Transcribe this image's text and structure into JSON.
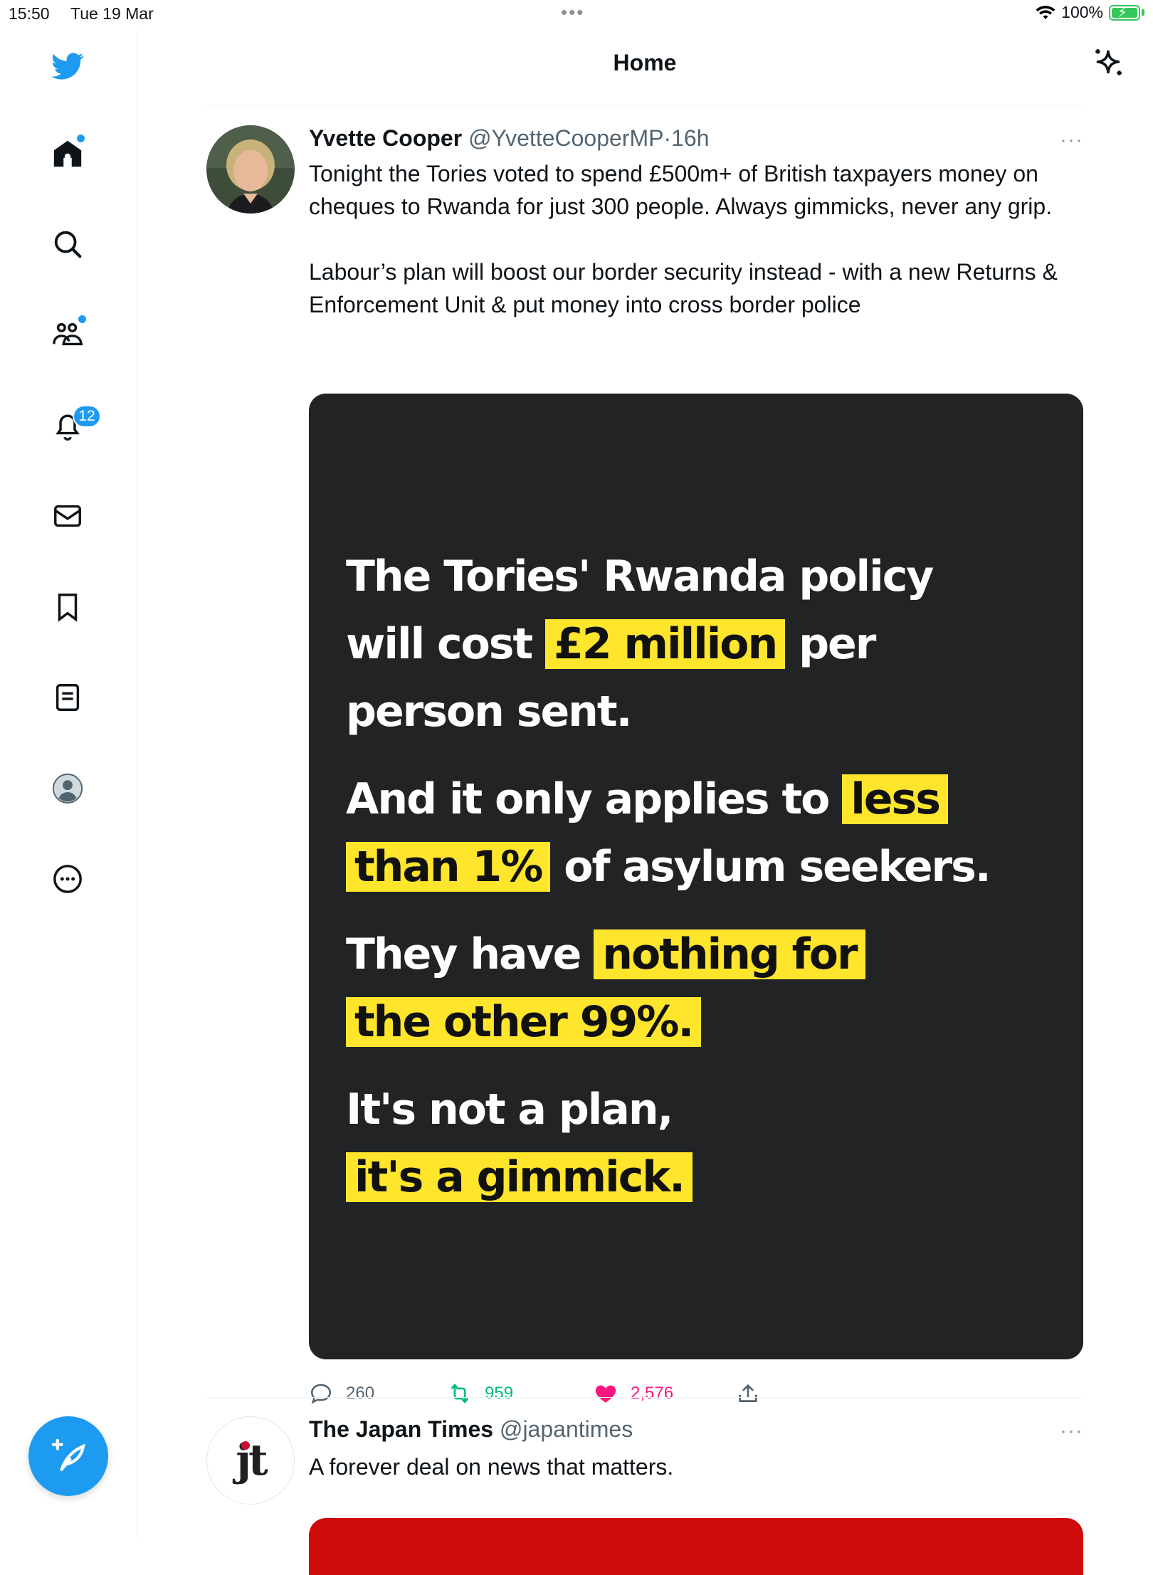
{
  "status_bar": {
    "time": "15:50",
    "date": "Tue 19 Mar",
    "battery": "100%"
  },
  "header": {
    "title": "Home"
  },
  "sidebar": {
    "items": [
      {
        "name": "logo",
        "icon": "twitter-bird-icon"
      },
      {
        "name": "home",
        "icon": "home-icon"
      },
      {
        "name": "explore",
        "icon": "search-icon"
      },
      {
        "name": "communities",
        "icon": "communities-icon"
      },
      {
        "name": "notifications",
        "icon": "bell-icon",
        "badge": "12"
      },
      {
        "name": "messages",
        "icon": "mail-icon"
      },
      {
        "name": "bookmarks",
        "icon": "bookmark-icon"
      },
      {
        "name": "lists",
        "icon": "list-icon"
      },
      {
        "name": "profile",
        "icon": "profile-avatar-icon"
      },
      {
        "name": "more",
        "icon": "more-circle-icon"
      }
    ],
    "compose_icon": "compose-feather-icon"
  },
  "tweets": [
    {
      "name": "Yvette Cooper",
      "handle": "@YvetteCooperMP",
      "sep": "·",
      "time": "16h",
      "more": "···",
      "text": "Tonight the Tories voted to spend £500m+ of British taxpayers money on cheques to Rwanda for just 300 people. Always gimmicks, never any grip.\n\nLabour’s plan will boost our border security instead - with a new Returns & Enforcement Unit & put money into cross border police",
      "media": {
        "p1_l1": "The Tories' Rwanda policy",
        "p1_l2a": "will cost ",
        "p1_l2b": "£2 million",
        "p1_l2c": " per",
        "p1_l3": "person sent.",
        "p2_l1a": "And it only applies to ",
        "p2_l1b": "less",
        "p2_l2a": "than 1%",
        "p2_l2b": " of asylum seekers.",
        "p3_l1a": "They have ",
        "p3_l1b": "nothing for",
        "p3_l2": "the other 99%.",
        "p4_l1": "It's not a plan,",
        "p4_l2": "it's a gimmick."
      },
      "replies": "260",
      "retweets": "959",
      "likes": "2,576"
    },
    {
      "name": "The Japan Times",
      "handle": "@japantimes",
      "more": "···",
      "text": "A forever deal on news that matters.",
      "avatar_text": "jt"
    }
  ],
  "colors": {
    "accent": "#1d9bf0",
    "like": "#f91880",
    "retweet": "#00ba7c",
    "highlight": "#ffe52c",
    "media_bg": "#212325"
  }
}
